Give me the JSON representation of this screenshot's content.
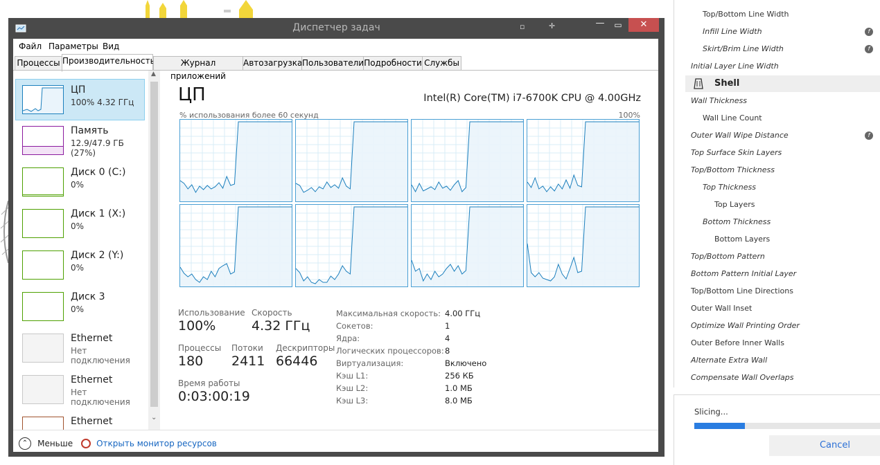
{
  "window": {
    "title": "Диспетчер задач",
    "menu": [
      "Файл",
      "Параметры",
      "Вид"
    ],
    "tabs": [
      "Процессы",
      "Производительность",
      "Журнал приложений",
      "Автозагрузка",
      "Пользователи",
      "Подробности",
      "Службы"
    ],
    "active_tab": "Производительность"
  },
  "sidebar": {
    "items": [
      {
        "name": "ЦП",
        "sub": "100%  4.32 ГГц",
        "color": "#1b7fbd"
      },
      {
        "name": "Память",
        "sub": "12.9/47.9 ГБ (27%)",
        "color": "#8b1a9e"
      },
      {
        "name": "Диск 0 (C:)",
        "sub": "0%",
        "color": "#4da000"
      },
      {
        "name": "Диск 1 (X:)",
        "sub": "0%",
        "color": "#4da000"
      },
      {
        "name": "Диск 2 (Y:)",
        "sub": "0%",
        "color": "#4da000"
      },
      {
        "name": "Диск 3",
        "sub": "0%",
        "color": "#4da000"
      },
      {
        "name": "Ethernet",
        "sub": "Нет подключения",
        "color": "#b0b0b0"
      },
      {
        "name": "Ethernet",
        "sub": "Нет подключения",
        "color": "#b0b0b0"
      },
      {
        "name": "Ethernet",
        "sub": "",
        "color": "#a0522d"
      }
    ]
  },
  "cpu": {
    "title": "ЦП",
    "model": "Intel(R) Core(TM) i7-6700K CPU @ 4.00GHz",
    "graph_caption": "% использования более 60 секунд",
    "graph_max": "100%",
    "stats": {
      "usage_label": "Использование",
      "usage": "100%",
      "speed_label": "Скорость",
      "speed": "4.32 ГГц",
      "processes_label": "Процессы",
      "processes": "180",
      "threads_label": "Потоки",
      "threads": "2411",
      "handles_label": "Дескрипторы",
      "handles": "66446",
      "uptime_label": "Время работы",
      "uptime": "0:03:00:19"
    },
    "info": [
      {
        "label": "Максимальная скорость:",
        "value": "4.00 ГГц"
      },
      {
        "label": "Сокетов:",
        "value": "1"
      },
      {
        "label": "Ядра:",
        "value": "4"
      },
      {
        "label": "Логических процессоров:",
        "value": "8"
      },
      {
        "label": "Виртуализация:",
        "value": "Включено"
      },
      {
        "label": "Кэш L1:",
        "value": "256 КБ"
      },
      {
        "label": "Кэш L2:",
        "value": "1.0 МБ"
      },
      {
        "label": "Кэш L3:",
        "value": "8.0 МБ"
      }
    ]
  },
  "footer": {
    "less_label": "Меньше",
    "resource_monitor_label": "Открыть монитор ресурсов"
  },
  "settings_panel": {
    "items": [
      {
        "label": "Top/Bottom Line Width",
        "italic": false,
        "indent": 1,
        "fx": false
      },
      {
        "label": "Infill Line Width",
        "italic": true,
        "indent": 1,
        "fx": true
      },
      {
        "label": "Skirt/Brim Line Width",
        "italic": true,
        "indent": 1,
        "fx": true
      },
      {
        "label": "Initial Layer Line Width",
        "italic": true,
        "indent": 0,
        "fx": false
      },
      {
        "label": "Shell",
        "italic": false,
        "indent": 0,
        "fx": false,
        "header": true
      },
      {
        "label": "Wall Thickness",
        "italic": true,
        "indent": 0,
        "fx": false
      },
      {
        "label": "Wall Line Count",
        "italic": false,
        "indent": 1,
        "fx": false
      },
      {
        "label": "Outer Wall Wipe Distance",
        "italic": true,
        "indent": 0,
        "fx": true
      },
      {
        "label": "Top Surface Skin Layers",
        "italic": true,
        "indent": 0,
        "fx": false
      },
      {
        "label": "Top/Bottom Thickness",
        "italic": true,
        "indent": 0,
        "fx": false
      },
      {
        "label": "Top Thickness",
        "italic": true,
        "indent": 1,
        "fx": false
      },
      {
        "label": "Top Layers",
        "italic": false,
        "indent": 2,
        "fx": false
      },
      {
        "label": "Bottom Thickness",
        "italic": true,
        "indent": 1,
        "fx": false
      },
      {
        "label": "Bottom Layers",
        "italic": false,
        "indent": 2,
        "fx": false
      },
      {
        "label": "Top/Bottom Pattern",
        "italic": true,
        "indent": 0,
        "fx": false
      },
      {
        "label": "Bottom Pattern Initial Layer",
        "italic": true,
        "indent": 0,
        "fx": false
      },
      {
        "label": "Top/Bottom Line Directions",
        "italic": false,
        "indent": 0,
        "fx": false
      },
      {
        "label": "Outer Wall Inset",
        "italic": false,
        "indent": 0,
        "fx": false
      },
      {
        "label": "Optimize Wall Printing Order",
        "italic": true,
        "indent": 0,
        "fx": false
      },
      {
        "label": "Outer Before Inner Walls",
        "italic": false,
        "indent": 0,
        "fx": false
      },
      {
        "label": "Alternate Extra Wall",
        "italic": true,
        "indent": 0,
        "fx": false
      },
      {
        "label": "Compensate Wall Overlaps",
        "italic": true,
        "indent": 0,
        "fx": false
      }
    ]
  },
  "slicing": {
    "status": "Slicing...",
    "progress": 0.27,
    "cancel_label": "Cancel"
  }
}
